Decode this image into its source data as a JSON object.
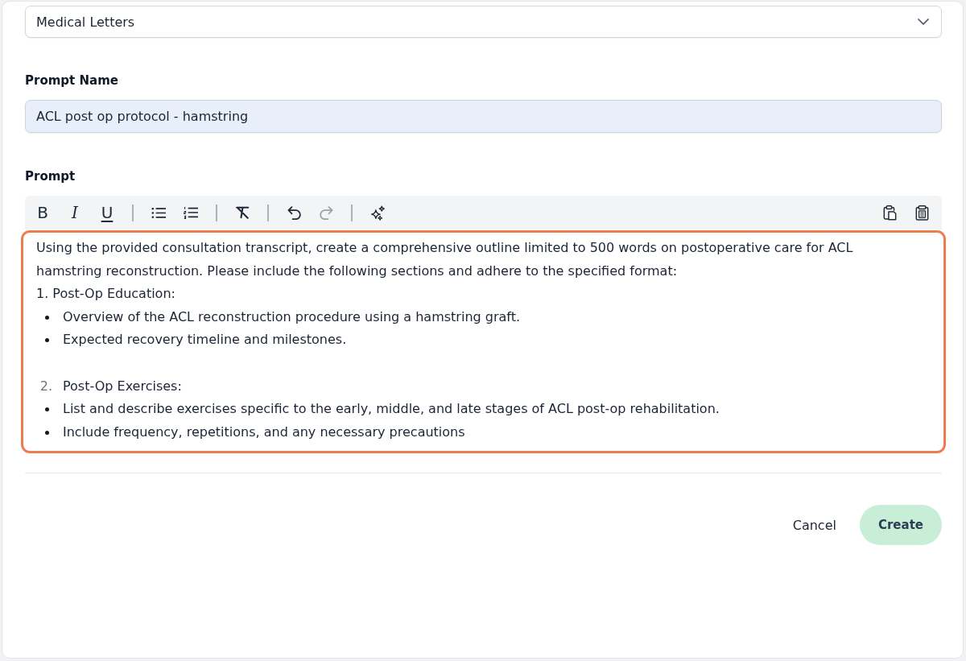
{
  "category_select": {
    "value": "Medical Letters"
  },
  "prompt_name": {
    "label": "Prompt Name",
    "value": "ACL post op protocol - hamstring"
  },
  "prompt": {
    "label": "Prompt",
    "toolbar": {
      "groups": [
        [
          {
            "kind": "bold",
            "label": "B",
            "disabled": false
          },
          {
            "kind": "italic",
            "label": "I",
            "disabled": false
          },
          {
            "kind": "underline",
            "label": "U",
            "disabled": false
          }
        ],
        [
          {
            "kind": "bullet_list",
            "disabled": false
          },
          {
            "kind": "numbered_list",
            "disabled": false
          }
        ],
        [
          {
            "kind": "clear_format",
            "disabled": false
          }
        ],
        [
          {
            "kind": "undo",
            "disabled": false
          },
          {
            "kind": "redo",
            "disabled": true
          }
        ],
        [
          {
            "kind": "sparkles",
            "disabled": false
          }
        ]
      ],
      "actions": [
        {
          "kind": "clipboard_page"
        },
        {
          "kind": "clipboard_list"
        }
      ]
    },
    "editor": {
      "focused": true,
      "blocks": [
        {
          "kind": "paragraph",
          "text": "Using the provided consultation transcript, create a comprehensive outline limited to 500 words on postoperative care for ACL hamstring reconstruction. Please include the following sections and adhere to the specified format:"
        },
        {
          "kind": "paragraph",
          "text": "1. Post-Op Education:"
        },
        {
          "kind": "bullets",
          "items": [
            "Overview of the ACL reconstruction procedure using a hamstring graft.",
            "Expected recovery timeline and milestones."
          ]
        },
        {
          "kind": "blank"
        },
        {
          "kind": "numbered",
          "number": "2.",
          "text": "Post-Op Exercises:"
        },
        {
          "kind": "bullets",
          "items": [
            "List and describe exercises specific to the early, middle, and late stages of ACL post-op rehabilitation.",
            "Include frequency, repetitions, and any necessary precautions"
          ]
        }
      ]
    }
  },
  "buttons": [
    {
      "kind": "secondary",
      "label": "Cancel"
    },
    {
      "kind": "primary",
      "label": "Create"
    }
  ]
}
